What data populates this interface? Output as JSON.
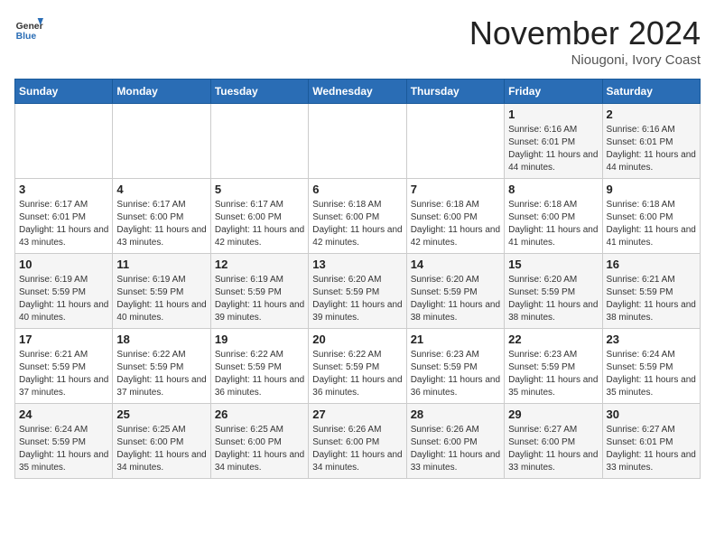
{
  "header": {
    "logo_line1": "General",
    "logo_line2": "Blue",
    "month": "November 2024",
    "location": "Niougoni, Ivory Coast"
  },
  "days_of_week": [
    "Sunday",
    "Monday",
    "Tuesday",
    "Wednesday",
    "Thursday",
    "Friday",
    "Saturday"
  ],
  "weeks": [
    [
      {
        "day": "",
        "info": ""
      },
      {
        "day": "",
        "info": ""
      },
      {
        "day": "",
        "info": ""
      },
      {
        "day": "",
        "info": ""
      },
      {
        "day": "",
        "info": ""
      },
      {
        "day": "1",
        "info": "Sunrise: 6:16 AM\nSunset: 6:01 PM\nDaylight: 11 hours and 44 minutes."
      },
      {
        "day": "2",
        "info": "Sunrise: 6:16 AM\nSunset: 6:01 PM\nDaylight: 11 hours and 44 minutes."
      }
    ],
    [
      {
        "day": "3",
        "info": "Sunrise: 6:17 AM\nSunset: 6:01 PM\nDaylight: 11 hours and 43 minutes."
      },
      {
        "day": "4",
        "info": "Sunrise: 6:17 AM\nSunset: 6:00 PM\nDaylight: 11 hours and 43 minutes."
      },
      {
        "day": "5",
        "info": "Sunrise: 6:17 AM\nSunset: 6:00 PM\nDaylight: 11 hours and 42 minutes."
      },
      {
        "day": "6",
        "info": "Sunrise: 6:18 AM\nSunset: 6:00 PM\nDaylight: 11 hours and 42 minutes."
      },
      {
        "day": "7",
        "info": "Sunrise: 6:18 AM\nSunset: 6:00 PM\nDaylight: 11 hours and 42 minutes."
      },
      {
        "day": "8",
        "info": "Sunrise: 6:18 AM\nSunset: 6:00 PM\nDaylight: 11 hours and 41 minutes."
      },
      {
        "day": "9",
        "info": "Sunrise: 6:18 AM\nSunset: 6:00 PM\nDaylight: 11 hours and 41 minutes."
      }
    ],
    [
      {
        "day": "10",
        "info": "Sunrise: 6:19 AM\nSunset: 5:59 PM\nDaylight: 11 hours and 40 minutes."
      },
      {
        "day": "11",
        "info": "Sunrise: 6:19 AM\nSunset: 5:59 PM\nDaylight: 11 hours and 40 minutes."
      },
      {
        "day": "12",
        "info": "Sunrise: 6:19 AM\nSunset: 5:59 PM\nDaylight: 11 hours and 39 minutes."
      },
      {
        "day": "13",
        "info": "Sunrise: 6:20 AM\nSunset: 5:59 PM\nDaylight: 11 hours and 39 minutes."
      },
      {
        "day": "14",
        "info": "Sunrise: 6:20 AM\nSunset: 5:59 PM\nDaylight: 11 hours and 38 minutes."
      },
      {
        "day": "15",
        "info": "Sunrise: 6:20 AM\nSunset: 5:59 PM\nDaylight: 11 hours and 38 minutes."
      },
      {
        "day": "16",
        "info": "Sunrise: 6:21 AM\nSunset: 5:59 PM\nDaylight: 11 hours and 38 minutes."
      }
    ],
    [
      {
        "day": "17",
        "info": "Sunrise: 6:21 AM\nSunset: 5:59 PM\nDaylight: 11 hours and 37 minutes."
      },
      {
        "day": "18",
        "info": "Sunrise: 6:22 AM\nSunset: 5:59 PM\nDaylight: 11 hours and 37 minutes."
      },
      {
        "day": "19",
        "info": "Sunrise: 6:22 AM\nSunset: 5:59 PM\nDaylight: 11 hours and 36 minutes."
      },
      {
        "day": "20",
        "info": "Sunrise: 6:22 AM\nSunset: 5:59 PM\nDaylight: 11 hours and 36 minutes."
      },
      {
        "day": "21",
        "info": "Sunrise: 6:23 AM\nSunset: 5:59 PM\nDaylight: 11 hours and 36 minutes."
      },
      {
        "day": "22",
        "info": "Sunrise: 6:23 AM\nSunset: 5:59 PM\nDaylight: 11 hours and 35 minutes."
      },
      {
        "day": "23",
        "info": "Sunrise: 6:24 AM\nSunset: 5:59 PM\nDaylight: 11 hours and 35 minutes."
      }
    ],
    [
      {
        "day": "24",
        "info": "Sunrise: 6:24 AM\nSunset: 5:59 PM\nDaylight: 11 hours and 35 minutes."
      },
      {
        "day": "25",
        "info": "Sunrise: 6:25 AM\nSunset: 6:00 PM\nDaylight: 11 hours and 34 minutes."
      },
      {
        "day": "26",
        "info": "Sunrise: 6:25 AM\nSunset: 6:00 PM\nDaylight: 11 hours and 34 minutes."
      },
      {
        "day": "27",
        "info": "Sunrise: 6:26 AM\nSunset: 6:00 PM\nDaylight: 11 hours and 34 minutes."
      },
      {
        "day": "28",
        "info": "Sunrise: 6:26 AM\nSunset: 6:00 PM\nDaylight: 11 hours and 33 minutes."
      },
      {
        "day": "29",
        "info": "Sunrise: 6:27 AM\nSunset: 6:00 PM\nDaylight: 11 hours and 33 minutes."
      },
      {
        "day": "30",
        "info": "Sunrise: 6:27 AM\nSunset: 6:01 PM\nDaylight: 11 hours and 33 minutes."
      }
    ]
  ]
}
